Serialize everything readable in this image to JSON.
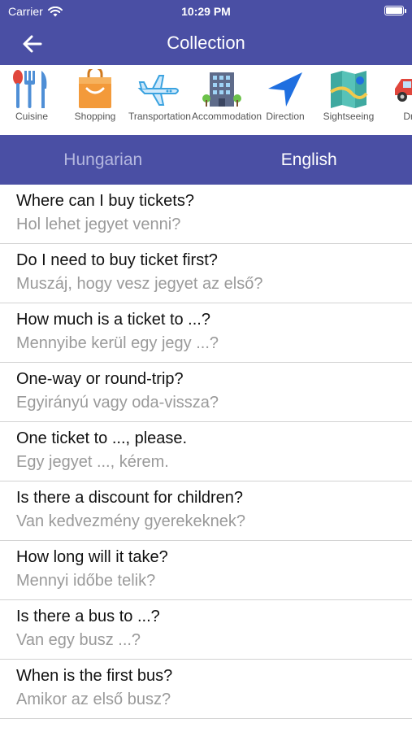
{
  "status_bar": {
    "carrier": "Carrier",
    "time": "10:29 PM",
    "wifi_icon": "wifi-icon",
    "battery_icon": "battery-icon"
  },
  "navbar": {
    "title": "Collection",
    "back_icon": "back-arrow-icon"
  },
  "categories": [
    {
      "label": "Cuisine",
      "icon": "cutlery-icon"
    },
    {
      "label": "Shopping",
      "icon": "shopping-bag-icon"
    },
    {
      "label": "Transportation",
      "icon": "airplane-icon"
    },
    {
      "label": "Accommodation",
      "icon": "hotel-icon"
    },
    {
      "label": "Direction",
      "icon": "navigation-icon"
    },
    {
      "label": "Sightseeing",
      "icon": "map-icon"
    },
    {
      "label": "Driv",
      "icon": "car-icon"
    }
  ],
  "tabs": [
    {
      "label": "Hungarian",
      "active": false
    },
    {
      "label": "English",
      "active": true
    }
  ],
  "phrases": [
    {
      "en": "Where can I buy tickets?",
      "hu": "Hol lehet jegyet venni?"
    },
    {
      "en": "Do I need to buy ticket first?",
      "hu": "Muszáj, hogy vesz jegyet az első?"
    },
    {
      "en": "How much is a ticket to ...?",
      "hu": "Mennyibe kerül egy jegy ...?"
    },
    {
      "en": "One-way or round-trip?",
      "hu": "Egyirányú vagy oda-vissza?"
    },
    {
      "en": "One ticket to ..., please.",
      "hu": "Egy jegyet ..., kérem."
    },
    {
      "en": "Is there a discount for children?",
      "hu": "Van kedvezmény gyerekeknek?"
    },
    {
      "en": "How long will it take?",
      "hu": "Mennyi időbe telik?"
    },
    {
      "en": "Is there a bus to ...?",
      "hu": "Van egy busz ...?"
    },
    {
      "en": "When is the first bus?",
      "hu": "Amikor az első busz?"
    }
  ],
  "colors": {
    "primary": "#4a4fa4",
    "tab_inactive": "#b5b8e0",
    "phrase_secondary": "#9a9a9a"
  }
}
